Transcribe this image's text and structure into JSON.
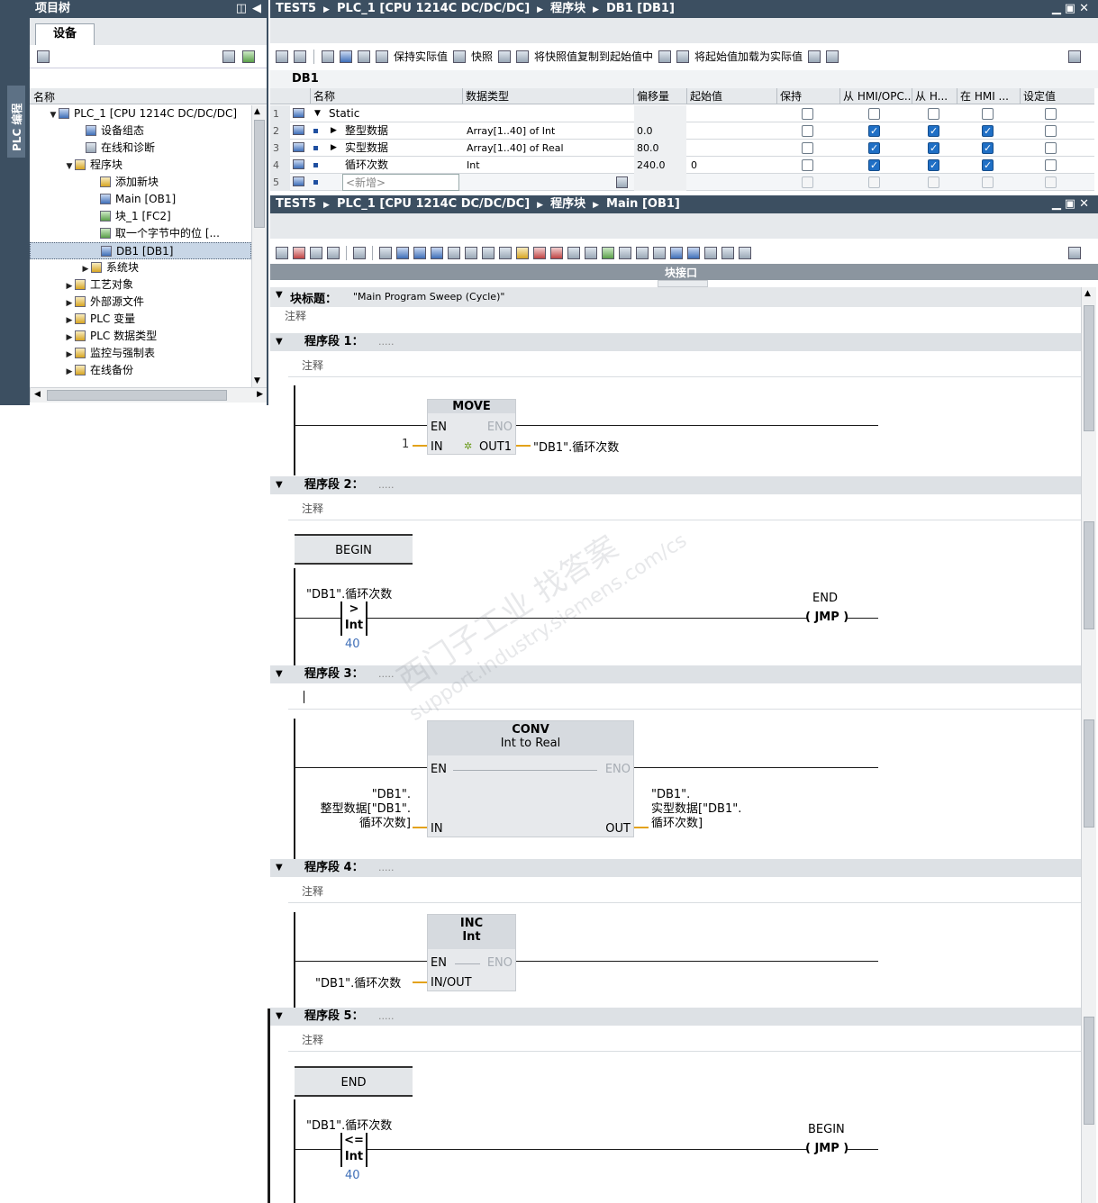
{
  "left_strip": {
    "label": "PLC 编程"
  },
  "project_tree": {
    "title": "项目树",
    "tab": "设备",
    "column_header": "名称",
    "items": [
      {
        "label": "PLC_1 [CPU 1214C DC/DC/DC]",
        "toggle": "▼",
        "icon": "plc-icon"
      },
      {
        "label": "设备组态",
        "toggle": "",
        "icon": "device-config-icon"
      },
      {
        "label": "在线和诊断",
        "toggle": "",
        "icon": "online-diagnostics-icon"
      },
      {
        "label": "程序块",
        "toggle": "▼",
        "icon": "folder-icon"
      },
      {
        "label": "添加新块",
        "toggle": "",
        "icon": "add-block-icon"
      },
      {
        "label": "Main [OB1]",
        "toggle": "",
        "icon": "ob-icon"
      },
      {
        "label": "块_1 [FC2]",
        "toggle": "",
        "icon": "fc-icon"
      },
      {
        "label": "取一个字节中的位 [...",
        "toggle": "",
        "icon": "fc-icon"
      },
      {
        "label": "DB1 [DB1]",
        "toggle": "",
        "icon": "db-icon"
      },
      {
        "label": "系统块",
        "toggle": "▶",
        "icon": "folder-icon"
      },
      {
        "label": "工艺对象",
        "toggle": "▶",
        "icon": "folder-icon"
      },
      {
        "label": "外部源文件",
        "toggle": "▶",
        "icon": "folder-icon"
      },
      {
        "label": "PLC 变量",
        "toggle": "▶",
        "icon": "folder-icon"
      },
      {
        "label": "PLC 数据类型",
        "toggle": "▶",
        "icon": "folder-icon"
      },
      {
        "label": "监控与强制表",
        "toggle": "▶",
        "icon": "folder-icon"
      },
      {
        "label": "在线备份",
        "toggle": "▶",
        "icon": "folder-icon"
      }
    ]
  },
  "db_editor": {
    "breadcrumb": [
      "TEST5",
      "PLC_1 [CPU 1214C DC/DC/DC]",
      "程序块",
      "DB1 [DB1]"
    ],
    "toolbar": {
      "keep_actual": "保持实际值",
      "snapshot": "快照",
      "copy_snapshot": "将快照值复制到起始值中",
      "load_start": "将起始值加载为实际值"
    },
    "db_name": "DB1",
    "columns": [
      "名称",
      "数据类型",
      "偏移量",
      "起始值",
      "保持",
      "从 HMI/OPC..",
      "从 H...",
      "在 HMI ...",
      "设定值"
    ],
    "rows": [
      {
        "num": "1",
        "name": "Static",
        "type": "",
        "offset": "",
        "start": "",
        "toggle": "▼",
        "flags": [
          false,
          false,
          false,
          false,
          false
        ]
      },
      {
        "num": "2",
        "name": "整型数据",
        "type": "Array[1..40] of Int",
        "offset": "0.0",
        "start": "",
        "toggle": "▶",
        "flags": [
          false,
          true,
          true,
          true,
          false
        ]
      },
      {
        "num": "3",
        "name": "实型数据",
        "type": "Array[1..40] of Real",
        "offset": "80.0",
        "start": "",
        "toggle": "▶",
        "flags": [
          false,
          true,
          true,
          true,
          false
        ]
      },
      {
        "num": "4",
        "name": "循环次数",
        "type": "Int",
        "offset": "240.0",
        "start": "0",
        "toggle": "",
        "flags": [
          false,
          true,
          true,
          true,
          false
        ]
      },
      {
        "num": "5",
        "name": "<新增>",
        "type": "",
        "offset": "",
        "start": "",
        "toggle": "",
        "flags": [
          false,
          false,
          false,
          false,
          false
        ]
      }
    ]
  },
  "main_editor": {
    "breadcrumb": [
      "TEST5",
      "PLC_1 [CPU 1214C DC/DC/DC]",
      "程序块",
      "Main [OB1]"
    ],
    "interface_label": "块接口",
    "block_title_label": "块标题：",
    "block_title_value": "\"Main Program Sweep (Cycle)\"",
    "comment": "注释",
    "networks": [
      {
        "label": "程序段 1：",
        "dots": "....."
      },
      {
        "label": "程序段 2：",
        "dots": "....."
      },
      {
        "label": "程序段 3：",
        "dots": "....."
      },
      {
        "label": "程序段 4：",
        "dots": "....."
      },
      {
        "label": "程序段 5：",
        "dots": "....."
      }
    ],
    "n1": {
      "box": "MOVE",
      "en": "EN",
      "eno": "ENO",
      "in": "IN",
      "out": "OUT1",
      "in_val": "1",
      "out_val": "\"DB1\".循环次数"
    },
    "n2": {
      "label": "BEGIN",
      "var": "\"DB1\".循环次数",
      "op": ">",
      "type": "Int",
      "cmp": "40",
      "coil_target": "END",
      "coil": "JMP"
    },
    "n3": {
      "box": "CONV",
      "from": "Int",
      "to_word": "to",
      "to": "Real",
      "en": "EN",
      "eno": "ENO",
      "in": "IN",
      "out": "OUT",
      "in_lines": [
        "\"DB1\".",
        "整型数据[\"DB1\".",
        "循环次数]"
      ],
      "out_lines": [
        "\"DB1\".",
        "实型数据[\"DB1\".",
        "循环次数]"
      ]
    },
    "n4": {
      "box": "INC",
      "type": "Int",
      "en": "EN",
      "eno": "ENO",
      "inout": "IN/OUT",
      "var": "\"DB1\".循环次数"
    },
    "n5": {
      "label": "END",
      "var": "\"DB1\".循环次数",
      "op": "<=",
      "type": "Int",
      "cmp": "40",
      "coil_target": "BEGIN",
      "coil": "JMP"
    }
  },
  "watermark": {
    "line1": "西门子工业  找答案",
    "line2": "support.industry.siemens.com/cs"
  }
}
